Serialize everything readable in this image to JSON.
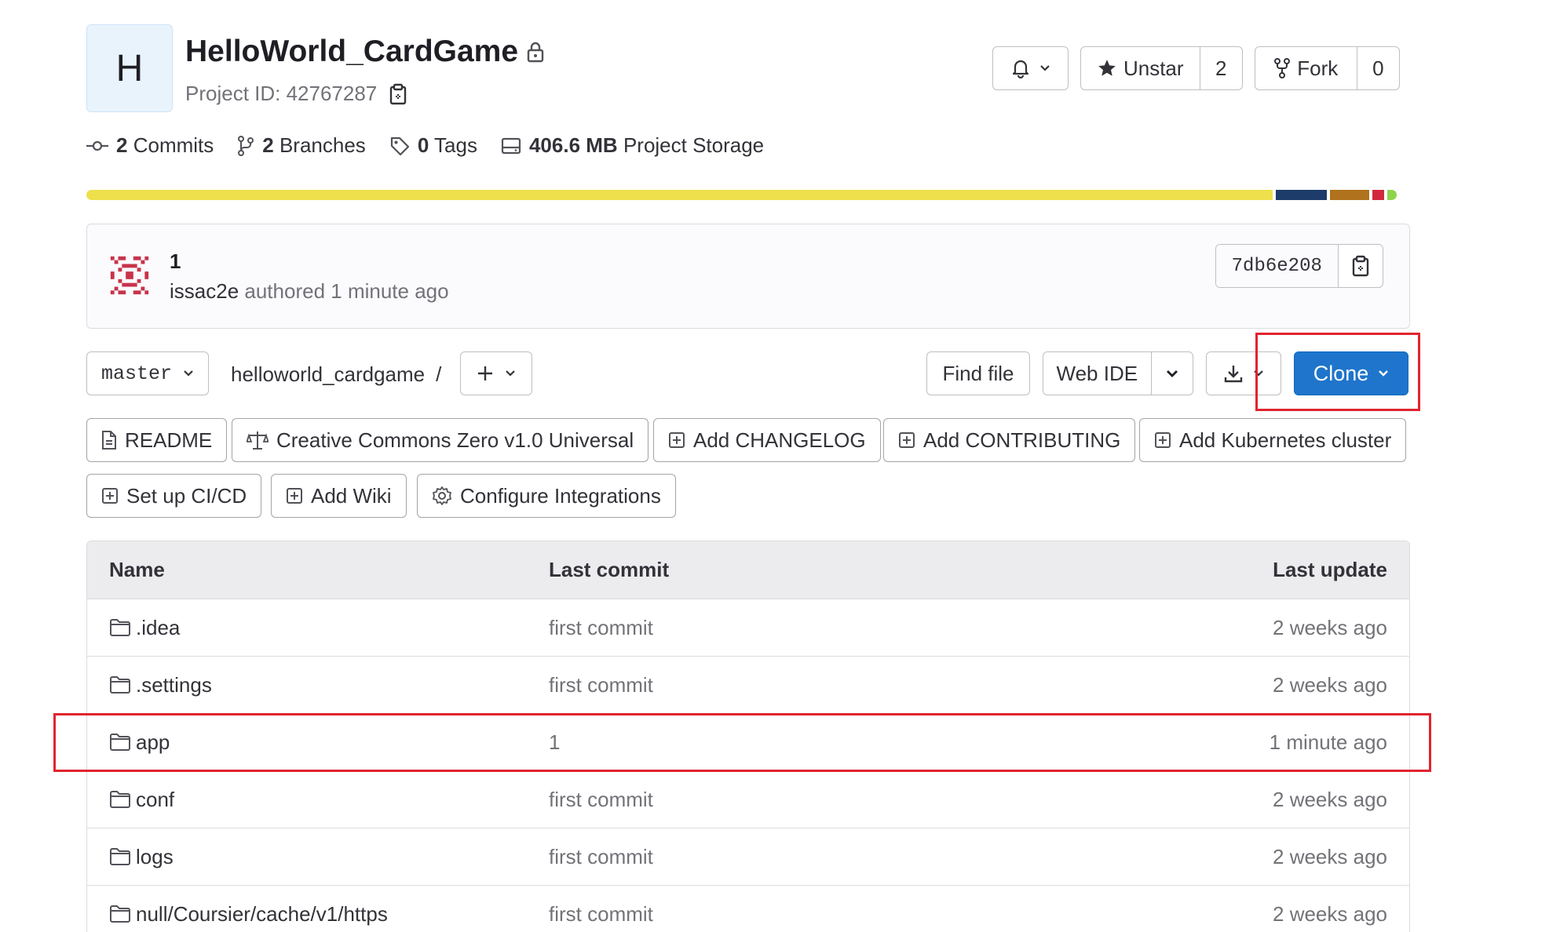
{
  "project": {
    "avatar_letter": "H",
    "name": "HelloWorld_CardGame",
    "id_label": "Project ID: 42767287"
  },
  "actions": {
    "unstar_label": "Unstar",
    "star_count": "2",
    "fork_label": "Fork",
    "fork_count": "0"
  },
  "stats": {
    "commits_count": "2",
    "commits_label": "Commits",
    "branches_count": "2",
    "branches_label": "Branches",
    "tags_count": "0",
    "tags_label": "Tags",
    "storage_size": "406.6 MB",
    "storage_label": "Project Storage"
  },
  "languages": [
    {
      "color": "#ede04c",
      "share": 0.905
    },
    {
      "color": "#1d3c69",
      "share": 0.039
    },
    {
      "color": "#b0721c",
      "share": 0.03
    },
    {
      "color": "#d2283c",
      "share": 0.009
    },
    {
      "color": "#8ed44b",
      "share": 0.007
    }
  ],
  "last_commit": {
    "title": "1",
    "author": "issac2e",
    "meta": "authored 1 minute ago",
    "sha": "7db6e208"
  },
  "toolbar": {
    "branch": "master",
    "path": "helloworld_cardgame",
    "separator": "/",
    "find_file": "Find file",
    "web_ide": "Web IDE",
    "clone": "Clone"
  },
  "quick_links": [
    {
      "label": "README",
      "icon": "file-icon"
    },
    {
      "label": "Creative Commons Zero v1.0 Universal",
      "icon": "scale-icon"
    },
    {
      "label": "Add CHANGELOG",
      "icon": "plus-square-icon"
    },
    {
      "label": "Add CONTRIBUTING",
      "icon": "plus-square-icon"
    },
    {
      "label": "Add Kubernetes cluster",
      "icon": "plus-square-icon"
    },
    {
      "label": "Set up CI/CD",
      "icon": "plus-square-icon"
    },
    {
      "label": "Add Wiki",
      "icon": "plus-square-icon"
    },
    {
      "label": "Configure Integrations",
      "icon": "gear-icon"
    }
  ],
  "table": {
    "headers": {
      "name": "Name",
      "commit": "Last commit",
      "update": "Last update"
    },
    "rows": [
      {
        "name": ".idea",
        "commit": "first commit",
        "update": "2 weeks ago"
      },
      {
        "name": ".settings",
        "commit": "first commit",
        "update": "2 weeks ago"
      },
      {
        "name": "app",
        "commit": "1",
        "update": "1 minute ago"
      },
      {
        "name": "conf",
        "commit": "first commit",
        "update": "2 weeks ago"
      },
      {
        "name": "logs",
        "commit": "first commit",
        "update": "2 weeks ago"
      },
      {
        "name": "null/Coursier/cache/v1/https",
        "commit": "first commit",
        "update": "2 weeks ago"
      }
    ]
  },
  "colors": {
    "primary": "#1f75cb",
    "highlight": "#e0242f"
  }
}
